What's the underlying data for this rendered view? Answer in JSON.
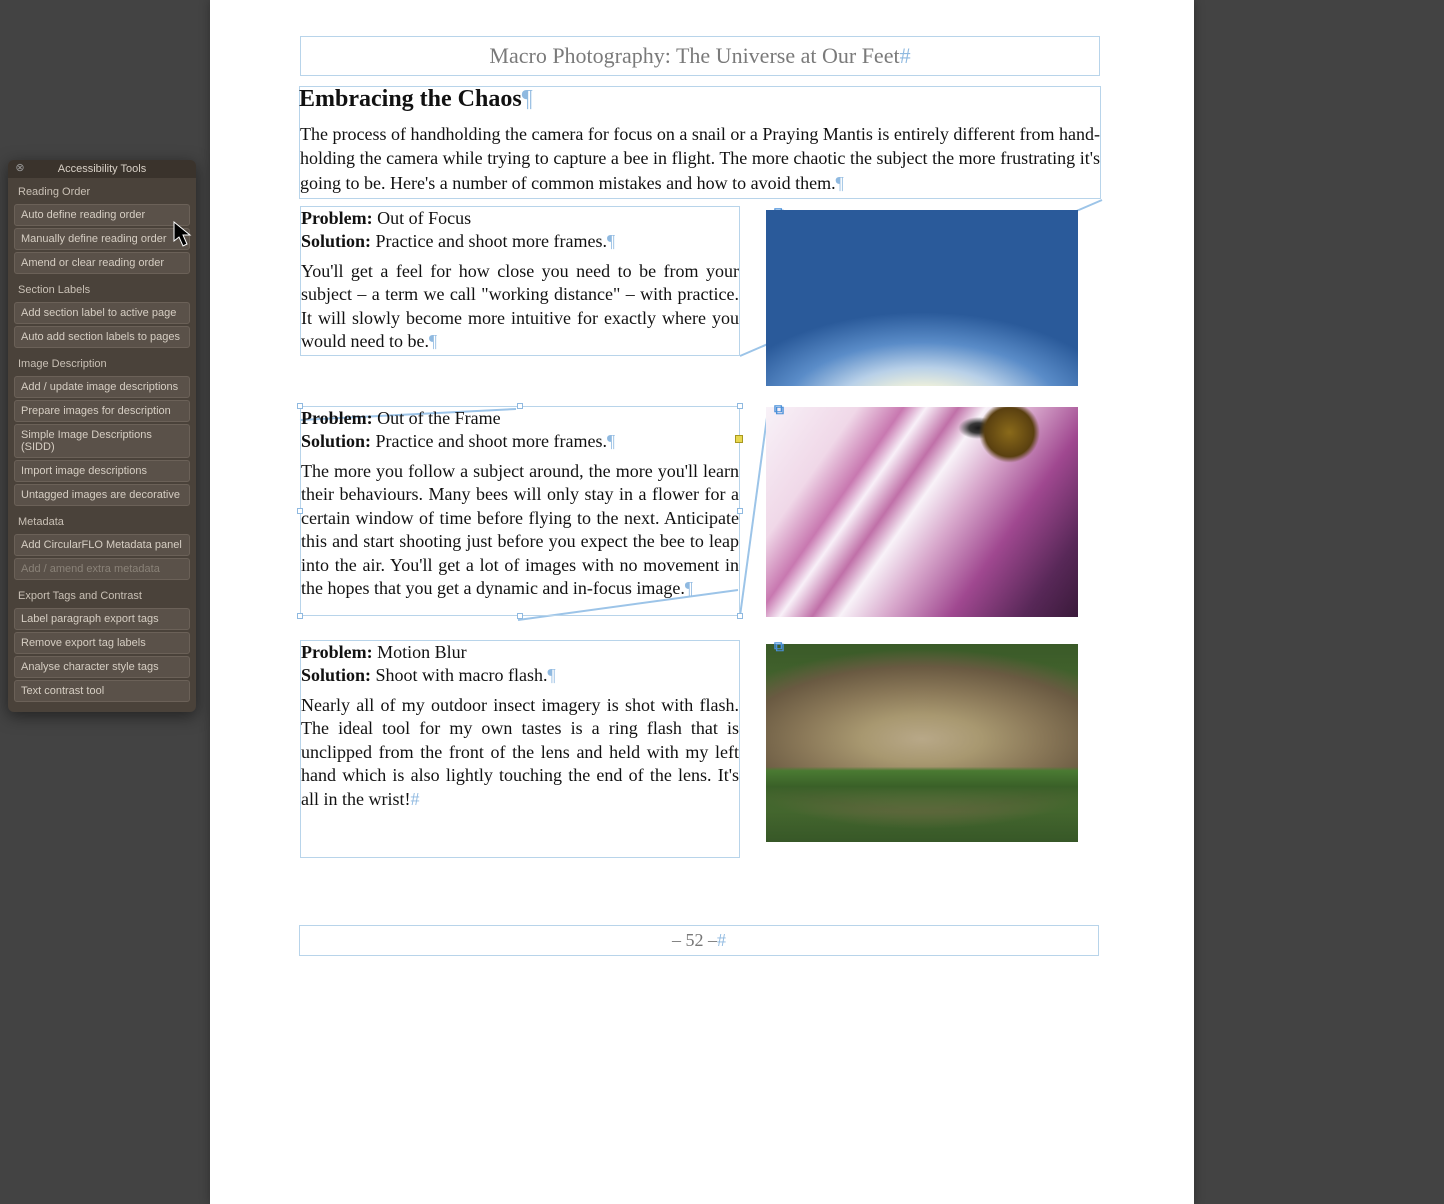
{
  "panel": {
    "title": "Accessibility Tools",
    "sections": [
      {
        "title": "Reading Order",
        "items": [
          "Auto define reading order",
          "Manually define reading order",
          "Amend or clear reading order"
        ]
      },
      {
        "title": "Section Labels",
        "items": [
          "Add section label to active page",
          "Auto add section labels to pages"
        ]
      },
      {
        "title": "Image Description",
        "items": [
          "Add / update image descriptions",
          "Prepare images for description",
          "Simple Image Descriptions (SIDD)",
          "Import image descriptions",
          "Untagged images are decorative"
        ]
      },
      {
        "title": "Metadata",
        "items": [
          "Add CircularFLO Metadata panel",
          "Add / amend extra metadata"
        ]
      },
      {
        "title": "Export Tags and Contrast",
        "items": [
          "Label paragraph export tags",
          "Remove export tag labels",
          "Analyse character style tags",
          "Text contrast tool"
        ]
      }
    ]
  },
  "document": {
    "running_head": "Macro Photography: The Universe at Our Feet",
    "h2": "Embracing the Chaos",
    "intro": "The process of handholding the camera for focus on a snail or a Praying Mantis is entirely different from hand-holding the camera while trying to capture a bee in flight. The more chaotic the subject the more frustrating it's going to be. Here's a number of common mistakes and how to avoid them.",
    "blocks": [
      {
        "problem_label": "Problem:",
        "problem": "Out of Focus",
        "solution_label": "Solution:",
        "solution": "Practice and shoot more frames.",
        "body": "You'll get a feel for how close you need to be from your subject – a term we call \"working distance\" – with practice. It will slowly become more intuitive for exactly where you would need to be."
      },
      {
        "problem_label": "Problem:",
        "problem": "Out of the Frame",
        "solution_label": "Solution:",
        "solution": "Practice and shoot more frames.",
        "body": "The more you follow a subject around, the more you'll learn their behaviours. Many bees will only stay in a flower for a certain window of time before flying to the next. Anticipate this and start shooting just before you expect the bee to leap into the air. You'll get a lot of images with no movement in the hopes that you get a dynamic and in-focus image."
      },
      {
        "problem_label": "Problem:",
        "problem": "Motion Blur",
        "solution_label": "Solution:",
        "solution": "Shoot with macro flash.",
        "body": "Nearly all of my outdoor insect imagery is shot with flash. The ideal tool for my own tastes is a ring flash that is unclipped from the front of the lens and held with my left hand which is also lightly touching the end of the lens. It's all in the wrist!"
      }
    ],
    "page_number": "– 52 –"
  }
}
